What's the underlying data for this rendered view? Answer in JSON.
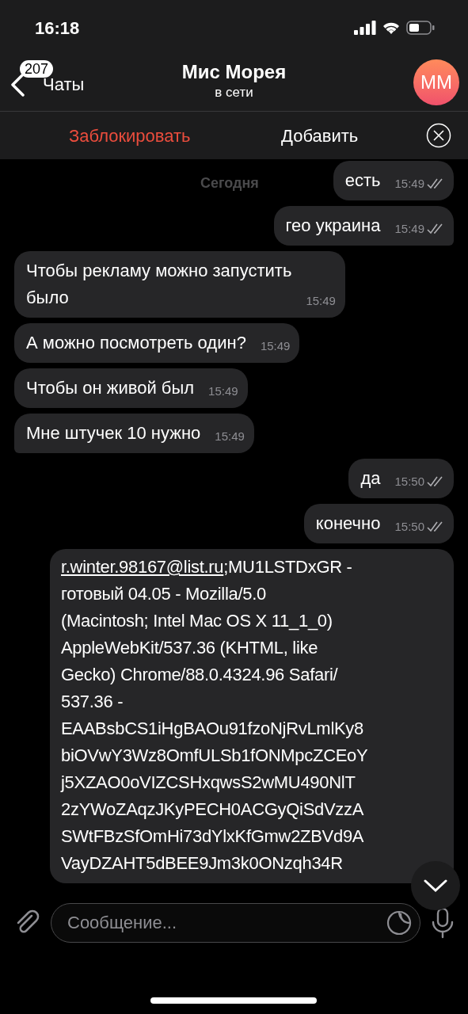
{
  "status_bar": {
    "time": "16:18"
  },
  "header": {
    "back_label": "Чаты",
    "unread_count": "207",
    "title": "Мис Морея",
    "subtitle": "в сети",
    "avatar_initials": "MM"
  },
  "action_bar": {
    "block": "Заблокировать",
    "add": "Добавить"
  },
  "date_label": "Сегодня",
  "messages": [
    {
      "outgoing": true,
      "lines": [
        "есть"
      ],
      "time": "15:49",
      "read": true
    },
    {
      "outgoing": true,
      "lines": [
        "гео украина"
      ],
      "time": "15:49",
      "read": true
    },
    {
      "outgoing": false,
      "lines": [
        "Чтобы рекламу можно запустить",
        "было"
      ],
      "time": "15:49",
      "tail": false
    },
    {
      "outgoing": false,
      "lines": [
        "А можно посмотреть один?"
      ],
      "time": "15:49",
      "tail": false
    },
    {
      "outgoing": false,
      "lines": [
        "Чтобы он живой был"
      ],
      "time": "15:49",
      "tail": false
    },
    {
      "outgoing": false,
      "lines": [
        "Мне штучек 10 нужно"
      ],
      "time": "15:49",
      "tail": true
    },
    {
      "outgoing": true,
      "lines": [
        "да"
      ],
      "time": "15:50",
      "read": true
    },
    {
      "outgoing": true,
      "lines": [
        "конечно"
      ],
      "time": "15:50",
      "read": true
    },
    {
      "outgoing": true,
      "link": "r.winter.98167@list.ru",
      "lines": [
        ";MU1LSTDxGR -",
        "готовый 04.05 - Mozilla/5.0",
        "(Macintosh; Intel Mac OS X 11_1_0)",
        "AppleWebKit/537.36 (KHTML, like",
        "Gecko) Chrome/88.0.4324.96 Safari/",
        "537.36 -",
        "EAABsbCS1iHgBAOu91fzoNjRvLmlKy8",
        "biOVwY3Wz8OmfULSb1fONMpcZCEoY",
        "j5XZAO0oVIZCSHxqwsS2wMU490NlT",
        "2zYWoZAqzJKyPECH0ACGyQiSdVzzA",
        "SWtFBzSfOmHi73dYlxKfGmw2ZBVd9A",
        "VayDZAHT5dBEE9Jm3k0ONzqh34R"
      ]
    }
  ],
  "composer": {
    "placeholder": "Сообщение..."
  }
}
